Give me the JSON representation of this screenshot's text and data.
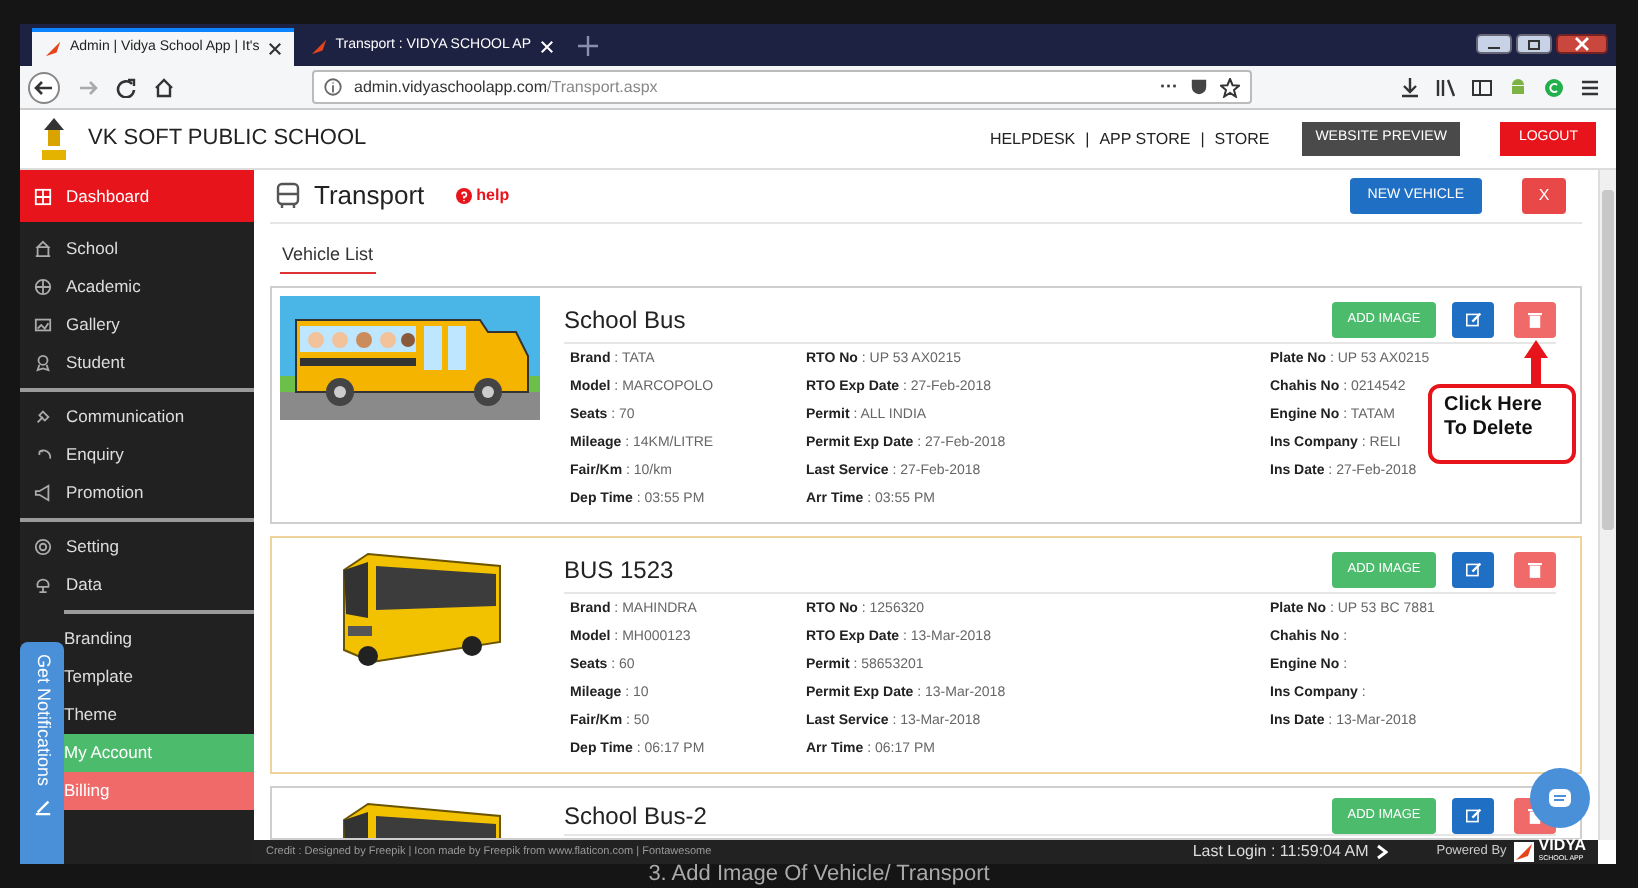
{
  "browser": {
    "tabs": [
      {
        "label": "Admin | Vidya School App | It's",
        "selected": true
      },
      {
        "label": "Transport : VIDYA SCHOOL AP",
        "selected": false
      }
    ],
    "url_host": "admin.vidyaschoolapp.com",
    "url_path": "/Transport.aspx",
    "more": "···"
  },
  "header": {
    "school": "VK SOFT PUBLIC SCHOOL",
    "links": [
      "HELPDESK",
      "|",
      "APP STORE",
      "|",
      "STORE"
    ],
    "preview": "WEBSITE PREVIEW",
    "logout": "LOGOUT"
  },
  "sidebar": {
    "groups": [
      {
        "items": [
          {
            "label": "Dashboard",
            "color": "#e8141b"
          }
        ]
      },
      {
        "items": [
          {
            "label": "School"
          },
          {
            "label": "Academic"
          },
          {
            "label": "Gallery"
          },
          {
            "label": "Student"
          }
        ]
      },
      {
        "items": [
          {
            "label": "Communication"
          },
          {
            "label": "Enquiry"
          },
          {
            "label": "Promotion"
          }
        ]
      },
      {
        "items": [
          {
            "label": "Setting"
          },
          {
            "label": "Data"
          }
        ]
      },
      {
        "items": [
          {
            "label": "Branding"
          },
          {
            "label": "Template"
          },
          {
            "label": "Theme"
          },
          {
            "label": "My Account",
            "color": "#4cbb6c"
          },
          {
            "label": "Billing",
            "color": "#f06a6a"
          }
        ]
      }
    ]
  },
  "page": {
    "title": "Transport",
    "help": "help",
    "new_vehicle": "NEW VEHICLE",
    "close": "X",
    "section": "Vehicle List"
  },
  "vehicles": [
    {
      "title": "School Bus",
      "kind": "cartoon",
      "selected": false,
      "add_image": "ADD IMAGE",
      "columns": [
        [
          "**Brand** : TATA",
          "**Model** : MARCOPOLO",
          "**Seats** : 70",
          "**Mileage** : 14KM/LITRE",
          "**Fair/Km** : 10/km",
          "**Dep Time** : 03:55 PM"
        ],
        [
          "**RTO No** : UP 53 AX0215",
          "**RTO Exp Date** : 27-Feb-2018",
          "**Permit** : ALL INDIA",
          "**Permit Exp Date** : 27-Feb-2018",
          "**Last Service** : 27-Feb-2018",
          "**Arr Time** : 03:55 PM"
        ],
        [
          "**Plate No** : UP 53 AX0215",
          "**Chahis No** : 0214542",
          "**Engine No** : TATAM",
          "**Ins Company** : RELI",
          "**Ins Date** : 27-Feb-2018"
        ]
      ]
    },
    {
      "title": "BUS 1523",
      "kind": "photo",
      "selected": true,
      "add_image": "ADD IMAGE",
      "columns": [
        [
          "**Brand** : MAHINDRA",
          "**Model** : MH000123",
          "**Seats** : 60",
          "**Mileage** : 10",
          "**Fair/Km** : 50",
          "**Dep Time** : 06:17 PM"
        ],
        [
          "**RTO No** : 1256320",
          "**RTO Exp Date** : 13-Mar-2018",
          "**Permit** : 58653201",
          "**Permit Exp Date** : 13-Mar-2018",
          "**Last Service** : 13-Mar-2018",
          "**Arr Time** : 06:17 PM"
        ],
        [
          "**Plate No** : UP 53 BC 7881",
          "**Chahis No** :",
          "**Engine No** :",
          "**Ins Company** :",
          "**Ins Date** : 13-Mar-2018"
        ]
      ]
    },
    {
      "title": "School Bus-2",
      "kind": "photo",
      "selected": false,
      "add_image": "ADD IMAGE"
    }
  ],
  "callout": "Click Here To Delete",
  "notifications": "Get Notifications",
  "footer": {
    "credit": "Credit : Designed by Freepik | Icon made by Freepik from www.flaticon.com | Fontawesome",
    "last_login": "Last Login : 11:59:04 AM",
    "powered": "Powered By",
    "logo": "VIDYA",
    "logo_sub": "SCHOOL APP"
  },
  "caption": "3. Add Image Of Vehicle/ Transport"
}
